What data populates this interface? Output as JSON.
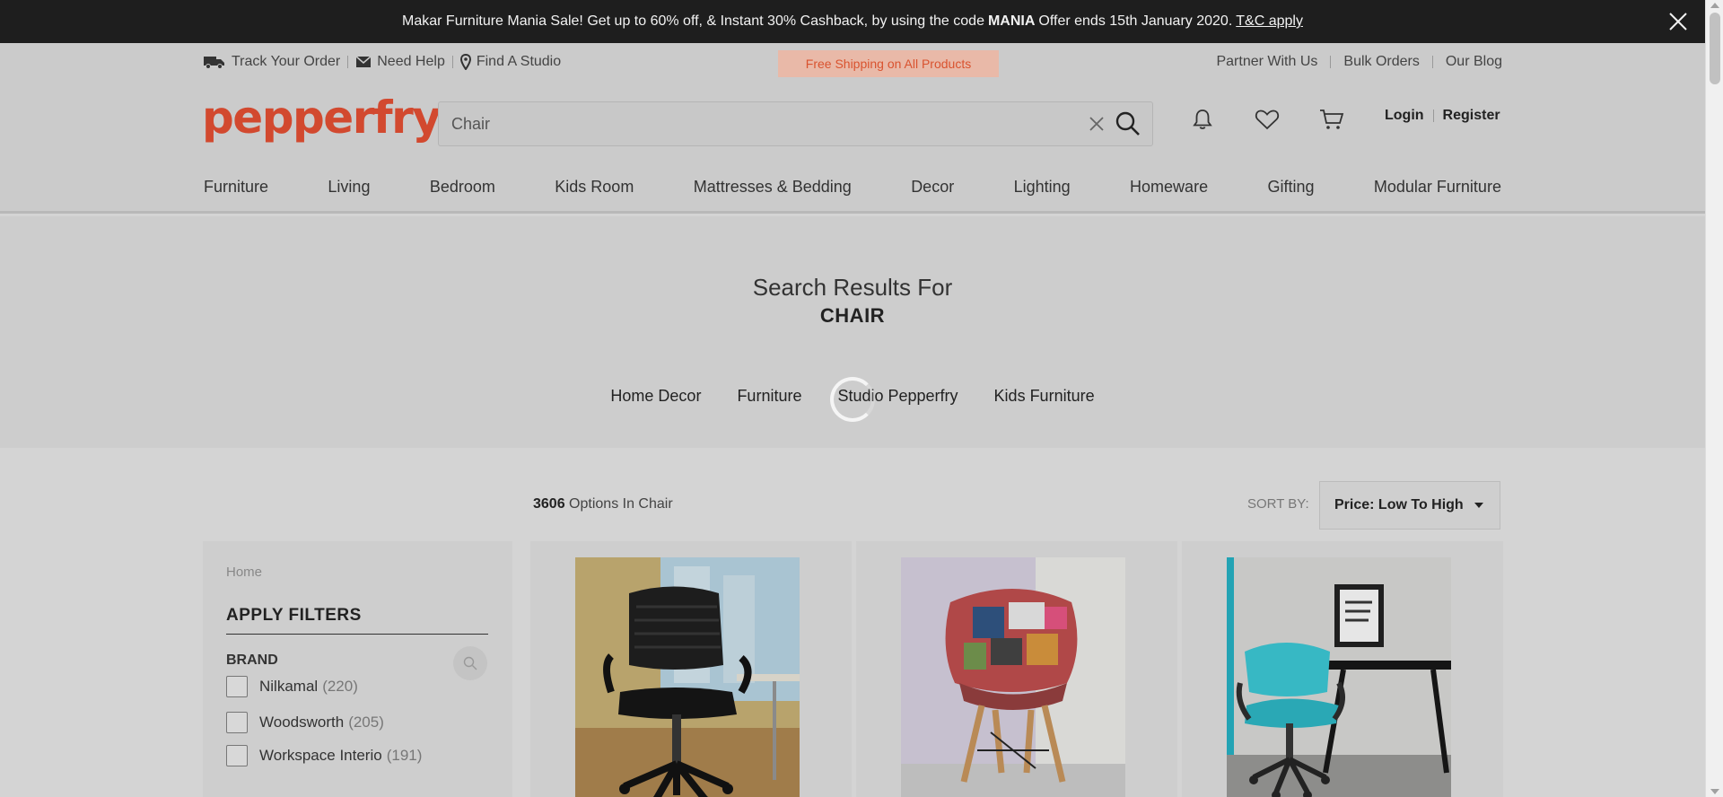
{
  "promo": {
    "text_before": "Makar Furniture Mania Sale! Get up to 60% off, & Instant 30% Cashback, by using the code",
    "code": "MANIA",
    "text_after": "Offer ends 15th January 2020.",
    "link": "T&C apply"
  },
  "utility": {
    "track": "Track Your Order",
    "help": "Need Help",
    "studio": "Find A Studio",
    "free_shipping": "Free Shipping on All Products",
    "partner": "Partner With Us",
    "bulk": "Bulk Orders",
    "blog": "Our Blog"
  },
  "header": {
    "logo": "pepperfry",
    "search_value": "Chair",
    "login": "Login",
    "register": "Register"
  },
  "nav": [
    "Furniture",
    "Living",
    "Bedroom",
    "Kids Room",
    "Mattresses & Bedding",
    "Decor",
    "Lighting",
    "Homeware",
    "Gifting",
    "Modular Furniture"
  ],
  "results": {
    "heading": "Search Results For",
    "term": "CHAIR",
    "subcategories": [
      "Home Decor",
      "Furniture",
      "Studio Pepperfry",
      "Kids Furniture"
    ]
  },
  "listing": {
    "count": "3606",
    "count_suffix": "Options In Chair",
    "sort_label": "SORT BY:",
    "sort_value": "Price: Low To High"
  },
  "filters": {
    "breadcrumb": "Home",
    "title": "APPLY FILTERS",
    "brand_label": "BRAND",
    "options": [
      {
        "name": "Nilkamal",
        "count": "(220)"
      },
      {
        "name": "Woodsworth",
        "count": "(205)"
      },
      {
        "name": "Workspace Interio",
        "count": "(191)"
      }
    ]
  },
  "colors": {
    "brand": "#d2492f",
    "promo_bg": "#1e1e1e",
    "free_shipping_bg": "#e9b9a8"
  },
  "icons": [
    "truck-icon",
    "mail-icon",
    "location-pin-icon",
    "close-icon",
    "clear-icon",
    "search-icon",
    "bell-icon",
    "heart-icon",
    "cart-icon",
    "loading-spinner-icon"
  ]
}
